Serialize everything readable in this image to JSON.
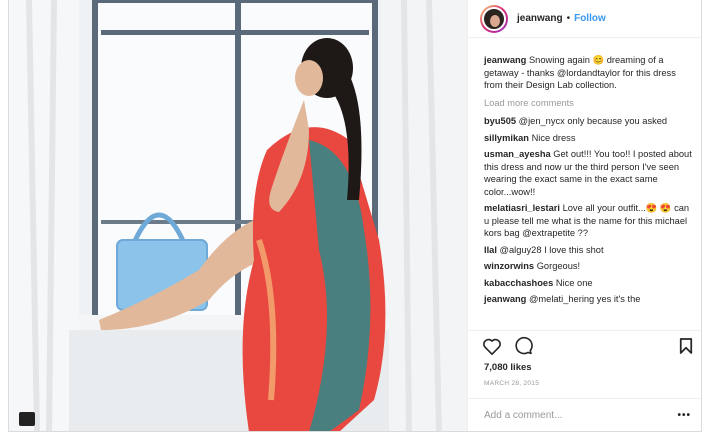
{
  "header": {
    "username": "jeanwang",
    "separator": "•",
    "follow_label": "Follow"
  },
  "caption": {
    "username": "jeanwang",
    "text": "Snowing again 😊 dreaming of a getaway - thanks @lordandtaylor for this dress from their Design Lab collection."
  },
  "load_more_label": "Load more comments",
  "comments": [
    {
      "user": "byu505",
      "text": "@jen_nycx only because you asked"
    },
    {
      "user": "sillymikan",
      "text": "Nice dress"
    },
    {
      "user": "usman_ayesha",
      "text": "Get out!!! You too!! I posted about this dress and now ur the third person I've seen wearing the exact same in the exact same color...wow!!"
    },
    {
      "user": "melatiasri_lestari",
      "text": "Love all your outfit...😍 😍 can u please tell me what is the name for this michael kors bag @extrapetite ??"
    },
    {
      "user": "llal",
      "text": "@alguy28 I love this shot"
    },
    {
      "user": "winzorwins",
      "text": "Gorgeous!"
    },
    {
      "user": "kabacchashoes",
      "text": "Nice one"
    },
    {
      "user": "jeanwang",
      "text": "@melati_hering yes it's the"
    }
  ],
  "likes": "7,080 likes",
  "date": "MARCH 28, 2015",
  "add_comment_placeholder": "Add a comment...",
  "more_options": "•••",
  "icons": {
    "like": "heart-icon",
    "comment": "comment-icon",
    "save": "bookmark-icon",
    "camera": "camera-icon"
  },
  "colors": {
    "link_blue": "#3897f0",
    "text": "#262626",
    "muted": "#999999"
  }
}
